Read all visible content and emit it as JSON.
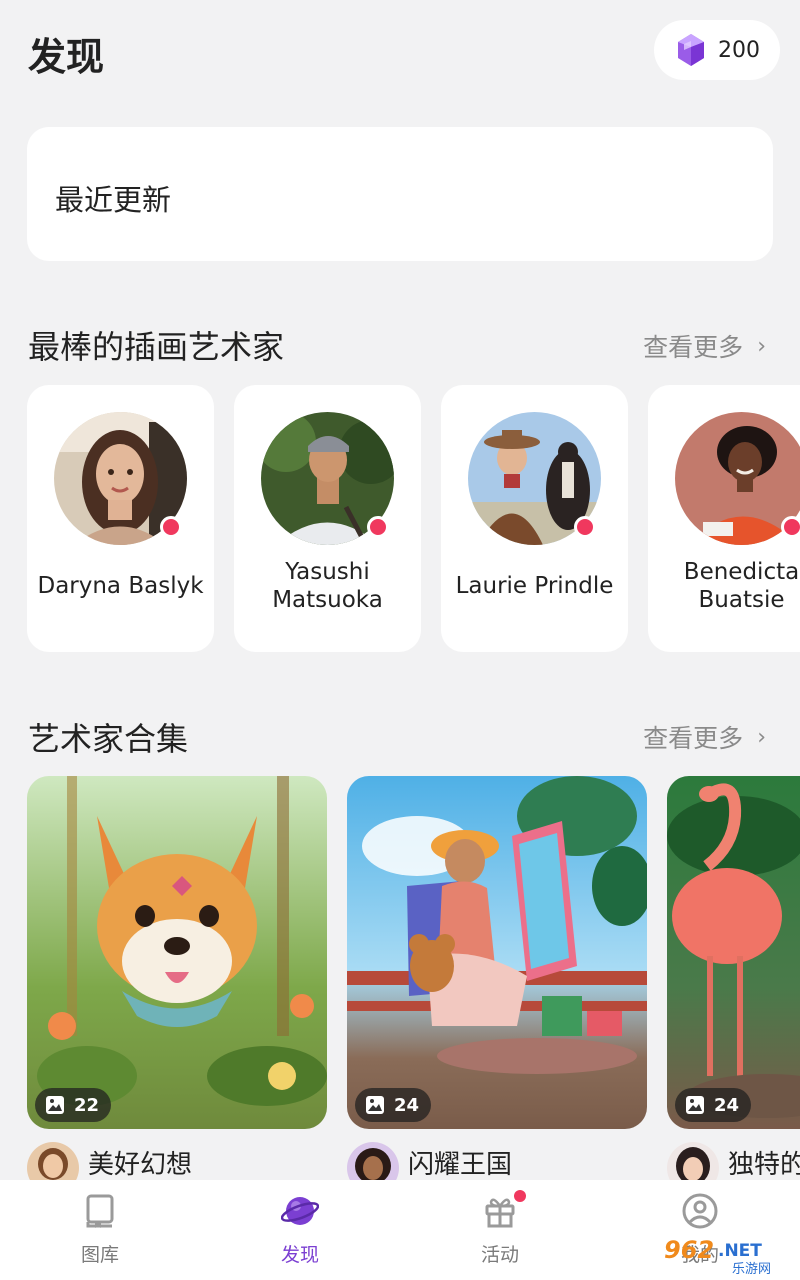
{
  "header": {
    "title": "发现",
    "gem_count": "200"
  },
  "recent": {
    "label": "最近更新"
  },
  "illustrators": {
    "title": "最棒的插画艺术家",
    "see_more": "查看更多",
    "artists": [
      {
        "name": "Daryna Baslyk"
      },
      {
        "name": "Yasushi Matsuoka"
      },
      {
        "name": "Laurie Prindle"
      },
      {
        "name": "Benedicta Buatsie"
      }
    ]
  },
  "collections": {
    "title": "艺术家合集",
    "see_more": "查看更多",
    "items": [
      {
        "count": "22",
        "author": "美好幻想"
      },
      {
        "count": "24",
        "author": "闪耀王国"
      },
      {
        "count": "24",
        "author": "独特的"
      }
    ]
  },
  "tabs": [
    {
      "label": "图库",
      "icon": "book-icon",
      "active": false
    },
    {
      "label": "发现",
      "icon": "planet-icon",
      "active": true
    },
    {
      "label": "活动",
      "icon": "gift-icon",
      "active": false,
      "badge": true
    },
    {
      "label": "我的",
      "icon": "profile-icon",
      "active": false
    }
  ],
  "watermark": {
    "text": "962.NET",
    "subtext": "乐游网"
  },
  "colors": {
    "accent": "#7b3fd2",
    "badge": "#f0385e",
    "background": "#f2f2f3"
  }
}
